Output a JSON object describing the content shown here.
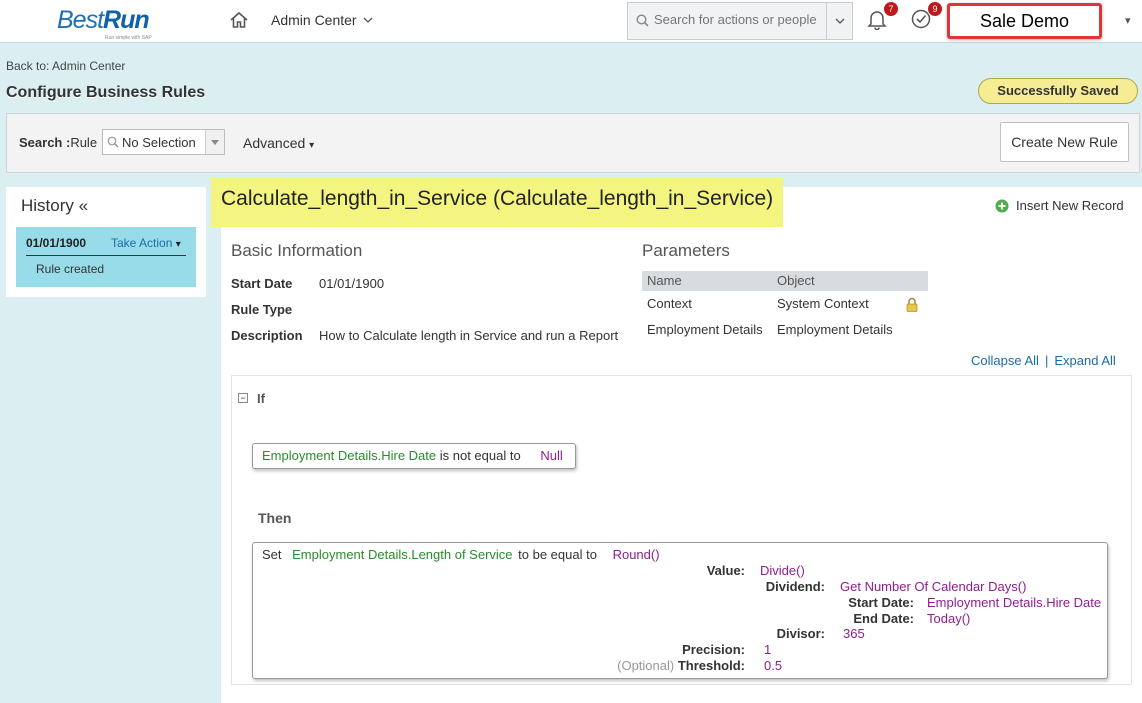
{
  "header": {
    "logo_text_a": "Best",
    "logo_text_b": "Run",
    "logo_tagline": "Run simple with SAP",
    "nav_menu": "Admin Center",
    "search_placeholder": "Search for actions or people",
    "notifications_count": "7",
    "tasks_count": "9",
    "user_name": "Sale Demo"
  },
  "breadcrumb": {
    "back_link": "Back to: Admin Center",
    "page_title": "Configure Business Rules",
    "status": "Successfully Saved"
  },
  "search": {
    "label_bold": "Search :",
    "label_rest": "Rule",
    "selection": "No Selection",
    "advanced": "Advanced",
    "create_button": "Create New Rule"
  },
  "history": {
    "title": "History «",
    "entries": [
      {
        "date": "01/01/1900",
        "action": "Take Action",
        "description": "Rule created"
      }
    ]
  },
  "rule": {
    "title": "Calculate_length_in_Service (Calculate_length_in_Service)",
    "insert_record": "Insert New Record",
    "basic_info": {
      "heading": "Basic Information",
      "start_date_label": "Start Date",
      "start_date": "01/01/1900",
      "rule_type_label": "Rule Type",
      "rule_type": "",
      "description_label": "Description",
      "description": "How to Calculate length in Service and run a Report"
    },
    "parameters": {
      "heading": "Parameters",
      "columns": [
        "Name",
        "Object"
      ],
      "rows": [
        {
          "name": "Context",
          "object": "System Context",
          "locked": true
        },
        {
          "name": "Employment Details",
          "object": "Employment Details",
          "locked": false
        }
      ]
    },
    "collapse_all": "Collapse All",
    "expand_all": "Expand All",
    "if_label": "If",
    "condition": {
      "field": "Employment Details.Hire Date",
      "operator": "is not equal to",
      "value": "Null"
    },
    "then_label": "Then",
    "action": {
      "set": "Set",
      "target": "Employment Details.Length of Service",
      "verb": "to be equal to",
      "function": "Round()",
      "value_label": "Value:",
      "value": "Divide()",
      "dividend_label": "Dividend:",
      "dividend": "Get Number Of Calendar Days()",
      "start_date_label": "Start Date:",
      "start_date": "Employment Details.Hire Date",
      "end_date_label": "End Date:",
      "end_date": "Today()",
      "divisor_label": "Divisor:",
      "divisor": "365",
      "precision_label": "Precision:",
      "precision": "1",
      "optional_label": "(Optional)",
      "threshold_label": "Threshold:",
      "threshold": "0.5"
    }
  }
}
